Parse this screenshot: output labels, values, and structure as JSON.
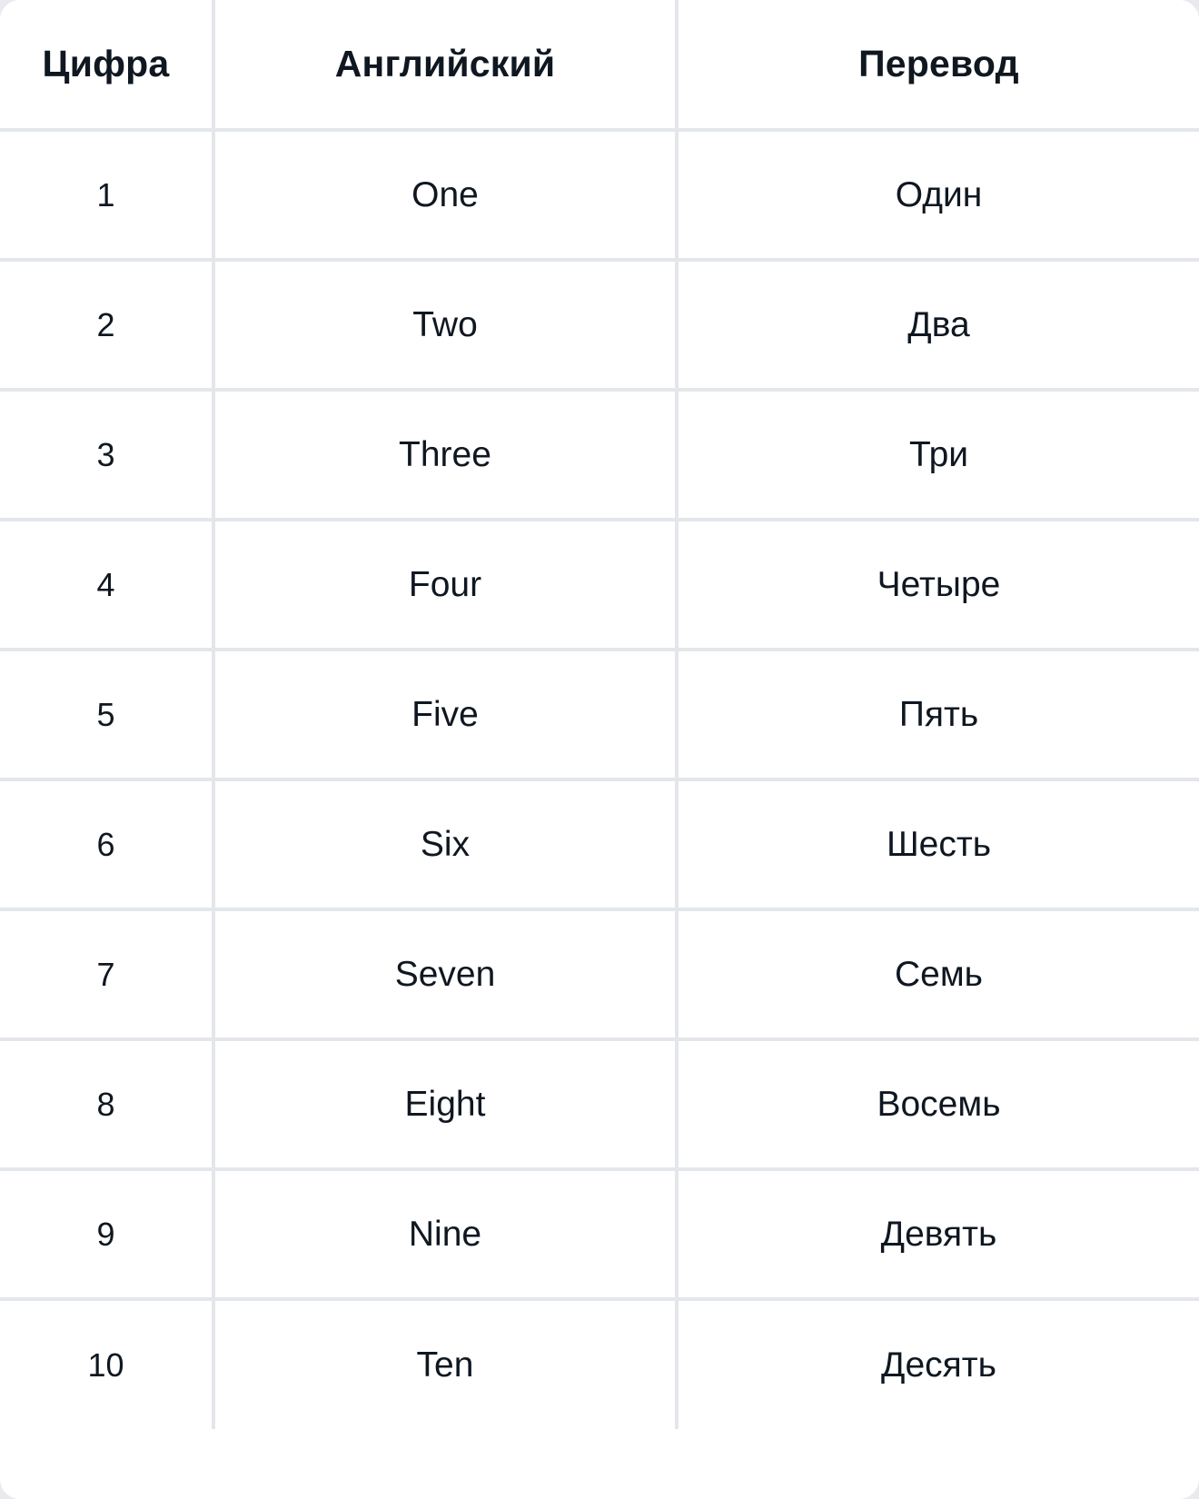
{
  "card": {
    "background_color": "#ffffff",
    "page_background_color": "#e8eaee",
    "border_color": "#e3e6ea",
    "text_color": "#0f1721"
  },
  "table": {
    "headers": {
      "digit": "Цифра",
      "english": "Английский",
      "russian": "Перевод"
    },
    "rows": [
      {
        "digit": "1",
        "english": "One",
        "russian": "Один"
      },
      {
        "digit": "2",
        "english": "Two",
        "russian": "Два"
      },
      {
        "digit": "3",
        "english": "Three",
        "russian": "Три"
      },
      {
        "digit": "4",
        "english": "Four",
        "russian": "Четыре"
      },
      {
        "digit": "5",
        "english": "Five",
        "russian": "Пять"
      },
      {
        "digit": "6",
        "english": "Six",
        "russian": "Шесть"
      },
      {
        "digit": "7",
        "english": "Seven",
        "russian": "Семь"
      },
      {
        "digit": "8",
        "english": "Eight",
        "russian": "Восемь"
      },
      {
        "digit": "9",
        "english": "Nine",
        "russian": "Девять"
      },
      {
        "digit": "10",
        "english": "Ten",
        "russian": "Десять"
      }
    ]
  }
}
